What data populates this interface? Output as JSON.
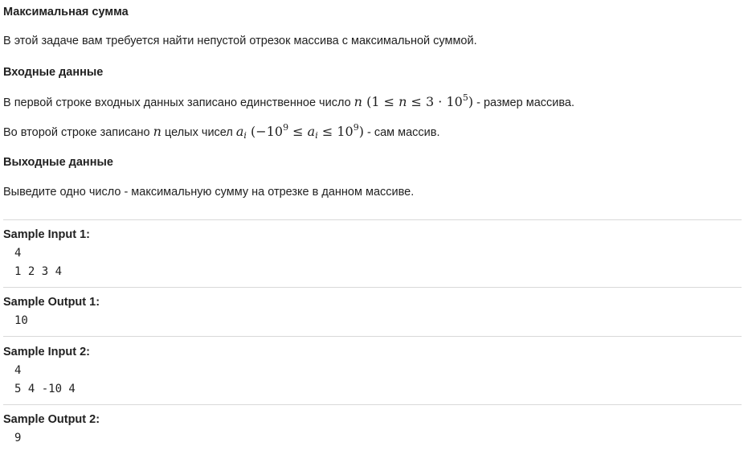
{
  "problem": {
    "title": "Максимальная сумма",
    "statement": "В этой задаче вам требуется найти непустой отрезок массива с максимальной суммой.",
    "input_heading": "Входные данные",
    "input_line1_prefix": "В первой строке входных данных записано единственное число",
    "input_line1_suffix": " -  размер массива.",
    "input_line2_prefix": "Во второй строке записано",
    "input_line2_middle": "целых чисел",
    "input_line2_suffix": " - сам массив.",
    "output_heading": "Выходные данные",
    "output_text": "Выведите одно число - максимальную сумму на отрезке в данном массиве."
  },
  "math": {
    "n": "n",
    "ai": "a",
    "ai_sub": "i",
    "constraint_n_lower": "1",
    "constraint_n_coef": "3",
    "constraint_n_base": "10",
    "constraint_n_exp": "5",
    "constraint_a_lower_base": "−10",
    "constraint_a_lower_exp": "9",
    "constraint_a_upper_base": "10",
    "constraint_a_upper_exp": "9"
  },
  "samples": [
    {
      "title": "Sample Input 1:",
      "body": "4\n1 2 3 4"
    },
    {
      "title": "Sample Output 1:",
      "body": "10"
    },
    {
      "title": "Sample Input 2:",
      "body": "4\n5 4 -10 4"
    },
    {
      "title": "Sample Output 2:",
      "body": "9"
    }
  ]
}
